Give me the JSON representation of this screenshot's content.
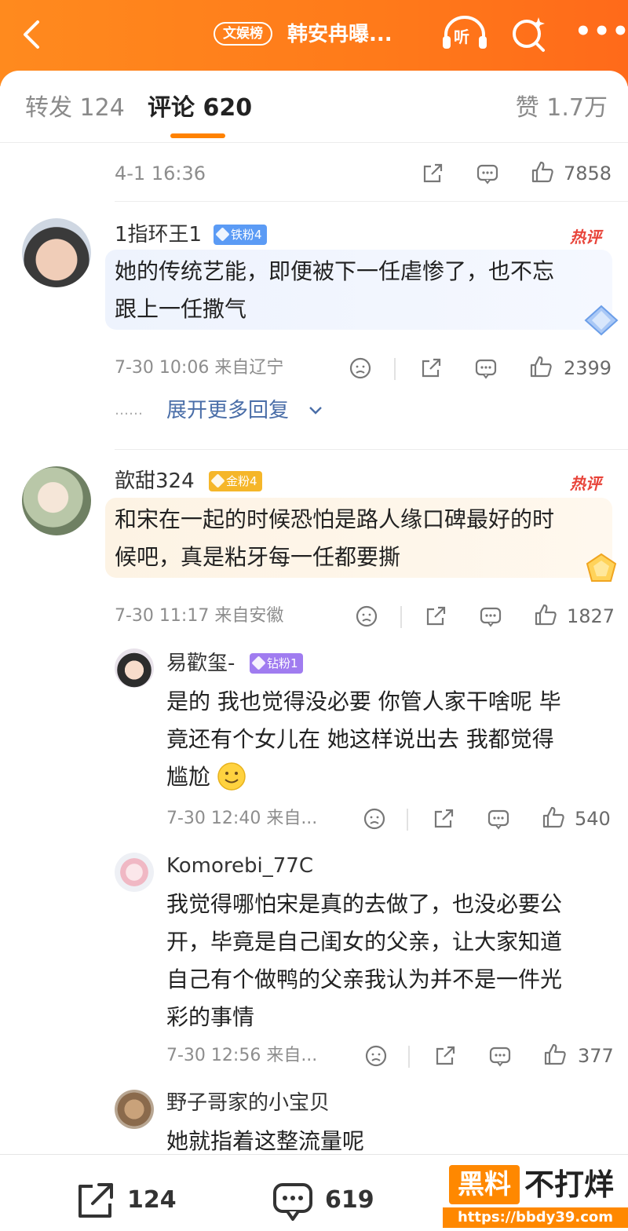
{
  "header": {
    "board_badge": "文娱榜",
    "title": "韩安冉曝...",
    "listen_label": "听"
  },
  "tabs": {
    "repost": "转发 124",
    "comment": "评论 620",
    "like": "赞 1.7万"
  },
  "post_meta": {
    "time": "4-1 16:36",
    "likes": "7858"
  },
  "comments": [
    {
      "name": "1指环王1",
      "badge": "铁粉4",
      "hot": "热评",
      "text_lines": [
        "她的传统艺能，即便被下一任虐惨了，也不忘",
        "跟上一任撒气"
      ],
      "meta": "7-30 10:06 来自辽宁",
      "likes": "2399",
      "expand": "展开更多回复",
      "dots": "……"
    },
    {
      "name": "歆甜324",
      "badge": "金粉4",
      "hot": "热评",
      "text_lines": [
        "和宋在一起的时候恐怕是路人缘口碑最好的时",
        "候吧，真是粘牙每一任都要撕"
      ],
      "meta": "7-30 11:17 来自安徽",
      "likes": "1827"
    }
  ],
  "replies": [
    {
      "name": "易歡玺-",
      "badge": "钻粉1",
      "text_lines": [
        "是的 我也觉得没必要 你管人家干啥呢 毕",
        "竟还有个女儿在 她这样说出去 我都觉得",
        "尴尬"
      ],
      "meta": "7-30 12:40 来自...",
      "likes": "540"
    },
    {
      "name": "Komorebi_77C",
      "text_lines": [
        "我觉得哪怕宋是真的去做了，也没必要公",
        "开，毕竟是自己闺女的父亲，让大家知道",
        "自己有个做鸭的父亲我认为并不是一件光",
        "彩的事情"
      ],
      "meta": "7-30 12:56 来自...",
      "likes": "377"
    },
    {
      "name": "野子哥家的小宝贝",
      "text_lines": [
        "她就指着这整流量呢"
      ]
    }
  ],
  "bottom": {
    "repost_count": "124",
    "comment_count": "619"
  },
  "watermark": {
    "box": "黑料",
    "text": "不打烊",
    "url": "https://bbdy39.com"
  },
  "colors": {
    "accent": "#ff8200",
    "hot": "#e8443a",
    "iron_badge": "#5b9bf5",
    "gold_badge": "#f5b629",
    "diamond_badge": "#a07cf0"
  }
}
